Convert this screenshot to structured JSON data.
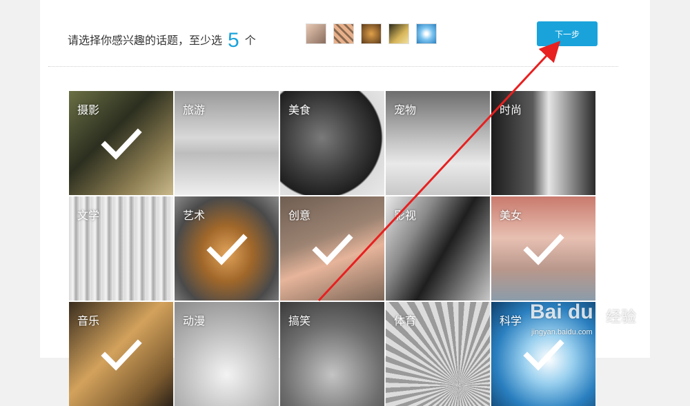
{
  "header": {
    "prompt_before": "请选择你感兴趣的话题，至少选",
    "min_count": "5",
    "prompt_after": "个",
    "next_button": "下一步"
  },
  "selected_thumbs": [
    {
      "icon": "portrait-thumb",
      "color": "#c9a58a"
    },
    {
      "icon": "grid-thumb",
      "color": "#d28b5e"
    },
    {
      "icon": "painting-thumb",
      "color": "#b07a3a"
    },
    {
      "icon": "gold-thumb",
      "color": "#c6a24a"
    },
    {
      "icon": "flower-thumb",
      "color": "#4aa3e0"
    }
  ],
  "topics": [
    {
      "label": "摄影",
      "selected": true
    },
    {
      "label": "旅游",
      "selected": false
    },
    {
      "label": "美食",
      "selected": false
    },
    {
      "label": "宠物",
      "selected": false
    },
    {
      "label": "时尚",
      "selected": false
    },
    {
      "label": "文学",
      "selected": false
    },
    {
      "label": "艺术",
      "selected": true
    },
    {
      "label": "创意",
      "selected": true
    },
    {
      "label": "影视",
      "selected": false
    },
    {
      "label": "美女",
      "selected": true
    },
    {
      "label": "音乐",
      "selected": true
    },
    {
      "label": "动漫",
      "selected": false
    },
    {
      "label": "搞笑",
      "selected": false
    },
    {
      "label": "体育",
      "selected": false
    },
    {
      "label": "科学",
      "selected": true
    }
  ],
  "watermark": {
    "logo": "Bai du",
    "cn": "经验",
    "url": "jingyan.baidu.com"
  },
  "colors": {
    "accent": "#1aa3db",
    "arrow": "#e82020"
  }
}
